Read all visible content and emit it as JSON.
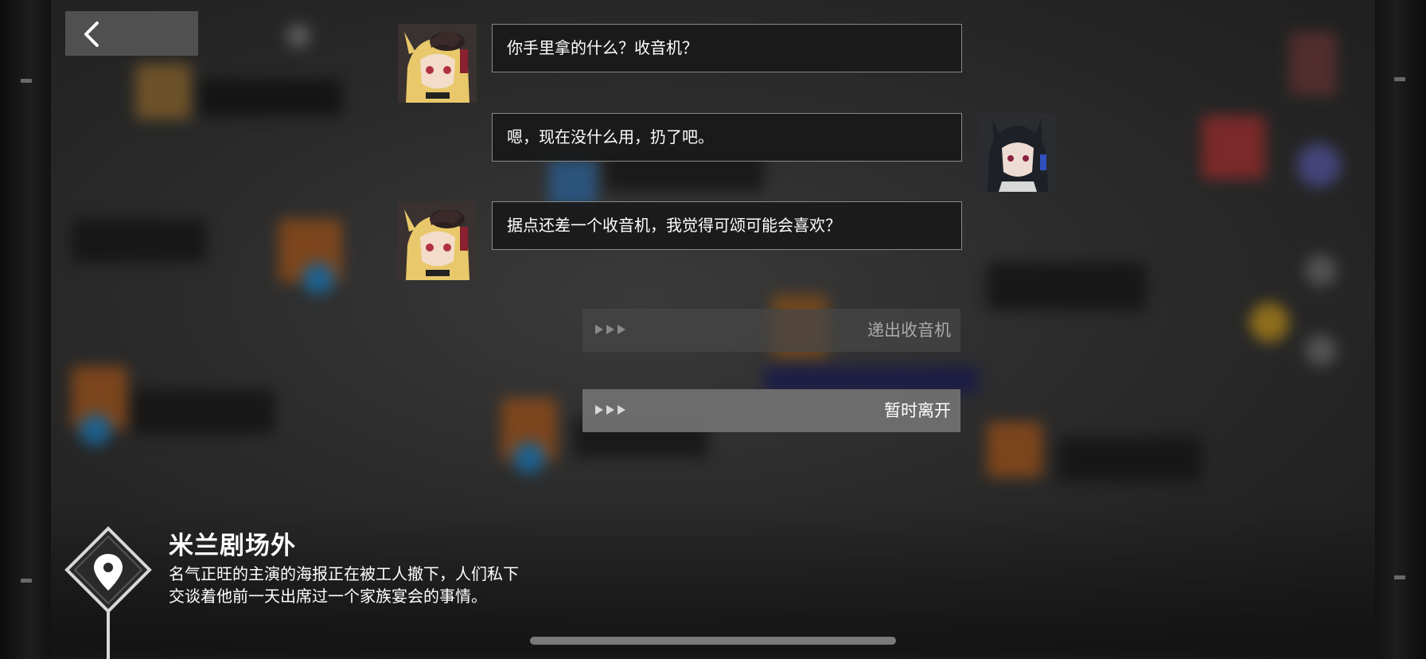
{
  "dialogue": [
    {
      "speaker_side": "left",
      "avatar_icon": "blonde-operator-portrait",
      "text": "你手里拿的什么？收音机？"
    },
    {
      "speaker_side": "right",
      "avatar_icon": "dark-haired-operator-portrait",
      "text": "嗯，现在没什么用，扔了吧。"
    },
    {
      "speaker_side": "left",
      "avatar_icon": "blonde-operator-portrait",
      "text": "据点还差一个收音机，我觉得可颂可能会喜欢？"
    }
  ],
  "choices": [
    {
      "label": "递出收音机",
      "state": "dimmed"
    },
    {
      "label": "暂时离开",
      "state": "highlighted"
    }
  ],
  "location": {
    "title": "米兰剧场外",
    "description_line1": "名气正旺的主演的海报正在被工人撤下，人们私下",
    "description_line2": "交谈着他前一天出席过一个家族宴会的事情。",
    "icon": "map-pin-icon"
  },
  "back_icon": "chevron-left-icon",
  "colors": {
    "bubble_border": "#8a8a8a",
    "bubble_fill": "#191919",
    "choice_highlight": "#707070",
    "choice_dim": "#464646"
  }
}
